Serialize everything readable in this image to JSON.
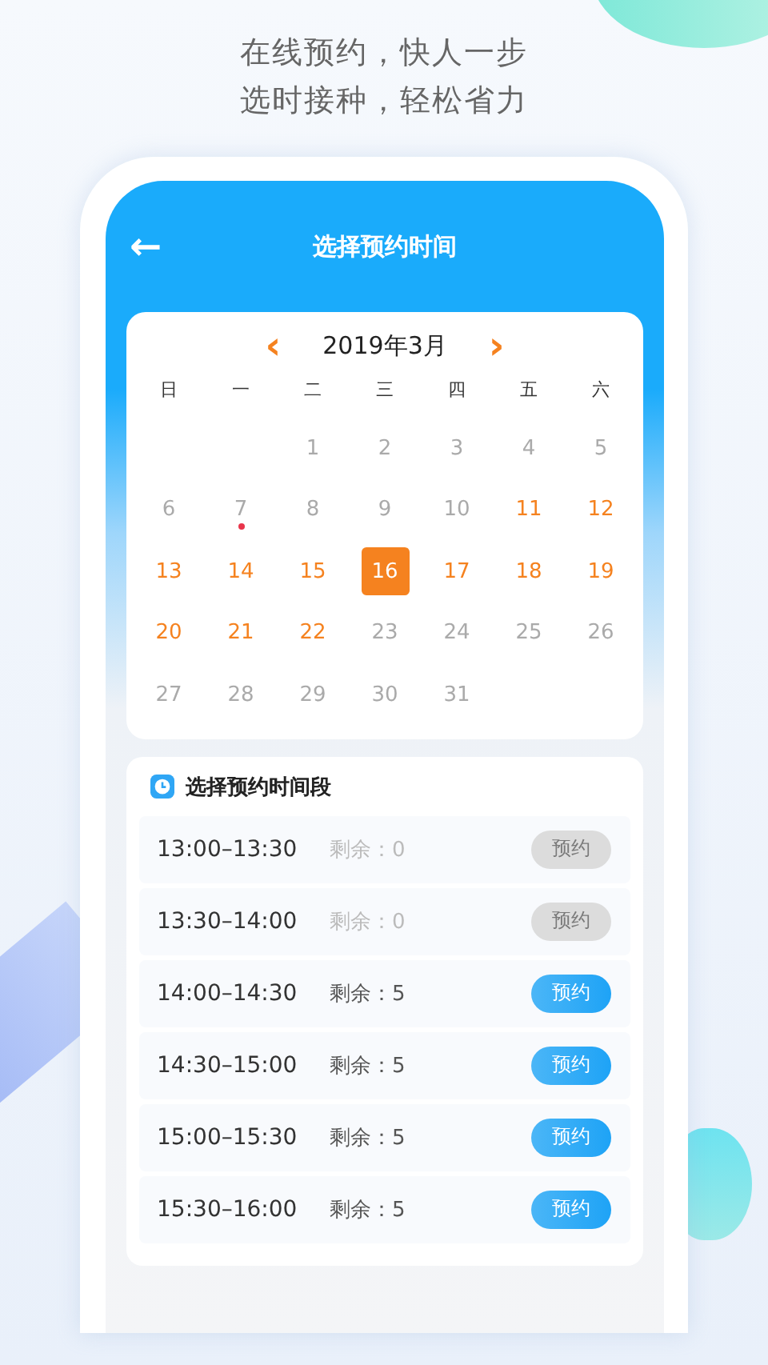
{
  "tagline": [
    "在线预约，快人一步",
    "选时接种，轻松省力"
  ],
  "nav": {
    "back_glyph": "←",
    "title": "选择预约时间"
  },
  "calendar": {
    "prev_glyph": "‹",
    "month": "2019年3月",
    "next_glyph": "›",
    "weekdays": [
      "日",
      "一",
      "二",
      "三",
      "四",
      "五",
      "六"
    ],
    "weeks": [
      [
        {
          "day": "1",
          "kind": "past",
          "selected": false,
          "marked": false
        },
        {
          "day": "2",
          "kind": "past",
          "selected": false,
          "marked": false
        },
        {
          "day": "3",
          "kind": "past",
          "selected": false,
          "marked": false
        },
        {
          "day": "4",
          "kind": "past",
          "selected": false,
          "marked": false
        },
        {
          "day": "5",
          "kind": "past",
          "selected": false,
          "marked": false
        }
      ],
      [
        {
          "day": "6",
          "kind": "past",
          "selected": false,
          "marked": false
        },
        {
          "day": "7",
          "kind": "past",
          "selected": false,
          "marked": true
        },
        {
          "day": "8",
          "kind": "past",
          "selected": false,
          "marked": false
        },
        {
          "day": "9",
          "kind": "past",
          "selected": false,
          "marked": false
        },
        {
          "day": "10",
          "kind": "past",
          "selected": false,
          "marked": false
        },
        {
          "day": "11",
          "kind": "open",
          "selected": false,
          "marked": false
        },
        {
          "day": "12",
          "kind": "open",
          "selected": false,
          "marked": false
        }
      ],
      [
        {
          "day": "13",
          "kind": "open",
          "selected": false,
          "marked": false
        },
        {
          "day": "14",
          "kind": "open",
          "selected": false,
          "marked": false
        },
        {
          "day": "15",
          "kind": "open",
          "selected": false,
          "marked": false
        },
        {
          "day": "16",
          "kind": "open",
          "selected": true,
          "marked": false
        },
        {
          "day": "17",
          "kind": "open",
          "selected": false,
          "marked": false
        },
        {
          "day": "18",
          "kind": "open",
          "selected": false,
          "marked": false
        },
        {
          "day": "19",
          "kind": "open",
          "selected": false,
          "marked": false
        }
      ],
      [
        {
          "day": "20",
          "kind": "open",
          "selected": false,
          "marked": false
        },
        {
          "day": "21",
          "kind": "open",
          "selected": false,
          "marked": false
        },
        {
          "day": "22",
          "kind": "open",
          "selected": false,
          "marked": false
        },
        {
          "day": "23",
          "kind": "past",
          "selected": false,
          "marked": false
        },
        {
          "day": "24",
          "kind": "past",
          "selected": false,
          "marked": false
        },
        {
          "day": "25",
          "kind": "past",
          "selected": false,
          "marked": false
        },
        {
          "day": "26",
          "kind": "past",
          "selected": false,
          "marked": false
        }
      ],
      [
        {
          "day": "27",
          "kind": "past",
          "selected": false,
          "marked": false
        },
        {
          "day": "28",
          "kind": "past",
          "selected": false,
          "marked": false
        },
        {
          "day": "29",
          "kind": "past",
          "selected": false,
          "marked": false
        },
        {
          "day": "30",
          "kind": "past",
          "selected": false,
          "marked": false
        },
        {
          "day": "31",
          "kind": "past",
          "selected": false,
          "marked": false
        }
      ]
    ]
  },
  "slots": {
    "title": "选择预约时间段",
    "items": [
      {
        "time": "13:00–13:30",
        "remaining": "剩余：0",
        "button": "预约",
        "disabled": true
      },
      {
        "time": "13:30–14:00",
        "remaining": "剩余：0",
        "button": "预约",
        "disabled": true
      },
      {
        "time": "14:00–14:30",
        "remaining": "剩余：5",
        "button": "预约",
        "disabled": false
      },
      {
        "time": "14:30–15:00",
        "remaining": "剩余：5",
        "button": "预约",
        "disabled": false
      },
      {
        "time": "15:00–15:30",
        "remaining": "剩余：5",
        "button": "预约",
        "disabled": false
      },
      {
        "time": "15:30–16:00",
        "remaining": "剩余：5",
        "button": "预约",
        "disabled": false
      }
    ]
  }
}
